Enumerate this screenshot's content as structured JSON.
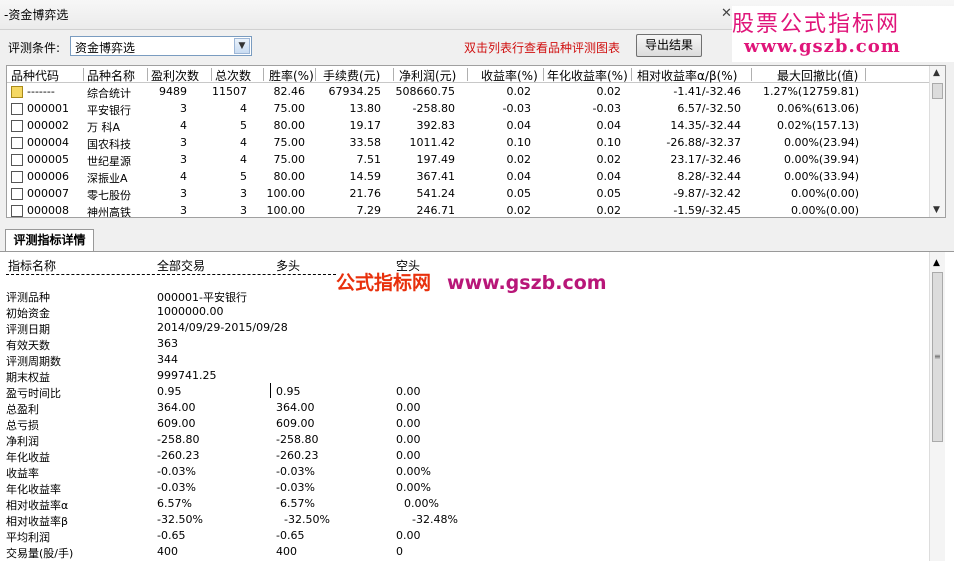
{
  "window": {
    "title": "-资金博弈选",
    "close_glyph": "✕"
  },
  "watermark_top": {
    "line1": "股票公式指标网",
    "line2": "www.gszb.com"
  },
  "toolbar": {
    "condition_label": "评测条件:",
    "condition_value": "资金博弈选",
    "hint": "双击列表行查看品种评测图表",
    "export_label": "导出结果"
  },
  "grid": {
    "columns": [
      "品种代码",
      "品种名称",
      "盈利次数",
      "总次数",
      "胜率(%)",
      "手续费(元)",
      "净利润(元)",
      "收益率(%)",
      "年化收益率(%)",
      "相对收益率α/β(%)",
      "最大回撤比(值)"
    ],
    "rows": [
      {
        "code": "-------",
        "name": "综合统计",
        "wins": "9489",
        "total": "11507",
        "winrate": "82.46",
        "fee": "67934.25",
        "profit": "508660.75",
        "ret": "0.02",
        "annual": "0.02",
        "rel": "-1.41/-32.46",
        "dd": "1.27%(12759.81)",
        "first": true
      },
      {
        "code": "000001",
        "name": "平安银行",
        "wins": "3",
        "total": "4",
        "winrate": "75.00",
        "fee": "13.80",
        "profit": "-258.80",
        "ret": "-0.03",
        "annual": "-0.03",
        "rel": "6.57/-32.50",
        "dd": "0.06%(613.06)"
      },
      {
        "code": "000002",
        "name": "万 科A",
        "wins": "4",
        "total": "5",
        "winrate": "80.00",
        "fee": "19.17",
        "profit": "392.83",
        "ret": "0.04",
        "annual": "0.04",
        "rel": "14.35/-32.44",
        "dd": "0.02%(157.13)"
      },
      {
        "code": "000004",
        "name": "国农科技",
        "wins": "3",
        "total": "4",
        "winrate": "75.00",
        "fee": "33.58",
        "profit": "1011.42",
        "ret": "0.10",
        "annual": "0.10",
        "rel": "-26.88/-32.37",
        "dd": "0.00%(23.94)"
      },
      {
        "code": "000005",
        "name": "世纪星源",
        "wins": "3",
        "total": "4",
        "winrate": "75.00",
        "fee": "7.51",
        "profit": "197.49",
        "ret": "0.02",
        "annual": "0.02",
        "rel": "23.17/-32.46",
        "dd": "0.00%(39.94)"
      },
      {
        "code": "000006",
        "name": "深振业A",
        "wins": "4",
        "total": "5",
        "winrate": "80.00",
        "fee": "14.59",
        "profit": "367.41",
        "ret": "0.04",
        "annual": "0.04",
        "rel": "8.28/-32.44",
        "dd": "0.00%(33.94)"
      },
      {
        "code": "000007",
        "name": "零七股份",
        "wins": "3",
        "total": "3",
        "winrate": "100.00",
        "fee": "21.76",
        "profit": "541.24",
        "ret": "0.05",
        "annual": "0.05",
        "rel": "-9.87/-32.42",
        "dd": "0.00%(0.00)"
      },
      {
        "code": "000008",
        "name": "神州高铁",
        "wins": "3",
        "total": "3",
        "winrate": "100.00",
        "fee": "7.29",
        "profit": "246.71",
        "ret": "0.02",
        "annual": "0.02",
        "rel": "-1.59/-32.45",
        "dd": "0.00%(0.00)"
      }
    ]
  },
  "detail": {
    "tab_label": "评测指标详情",
    "headers": [
      "指标名称",
      "全部交易",
      "多头",
      "空头"
    ],
    "watermark_cn": "公式指标网",
    "watermark_url": "www.gszb.com",
    "info_rows": [
      {
        "name": "评测品种",
        "v": "000001-平安银行"
      },
      {
        "name": "初始资金",
        "v": "1000000.00"
      },
      {
        "name": "评测日期",
        "v": "2014/09/29-2015/09/28"
      },
      {
        "name": "有效天数",
        "v": "363"
      },
      {
        "name": "评测周期数",
        "v": "344"
      },
      {
        "name": "期末权益",
        "v": "999741.25"
      }
    ],
    "stat_rows": [
      {
        "name": "盈亏时间比",
        "all": "0.95",
        "long": "0.95",
        "short": "0.00"
      },
      {
        "name": "总盈利",
        "all": "364.00",
        "long": "364.00",
        "short": "0.00"
      },
      {
        "name": "总亏损",
        "all": "609.00",
        "long": "609.00",
        "short": "0.00"
      },
      {
        "name": "净利润",
        "all": "-258.80",
        "long": "-258.80",
        "short": "0.00"
      },
      {
        "name": "年化收益",
        "all": "-260.23",
        "long": "-260.23",
        "short": "0.00"
      },
      {
        "name": "收益率",
        "all": "-0.03%",
        "long": "-0.03%",
        "short": "0.00%"
      },
      {
        "name": "年化收益率",
        "all": "-0.03%",
        "long": "-0.03%",
        "short": "0.00%"
      },
      {
        "name": "相对收益率α",
        "all": "6.57%",
        "long": "6.57%",
        "short": "0.00%"
      },
      {
        "name": "相对收益率β",
        "all": "-32.50%",
        "long": "-32.50%",
        "short": "-32.48%"
      },
      {
        "name": "平均利润",
        "all": "-0.65",
        "long": "-0.65",
        "short": "0.00"
      },
      {
        "name": "交易量(股/手)",
        "all": "400",
        "long": "400",
        "short": "0"
      }
    ]
  }
}
